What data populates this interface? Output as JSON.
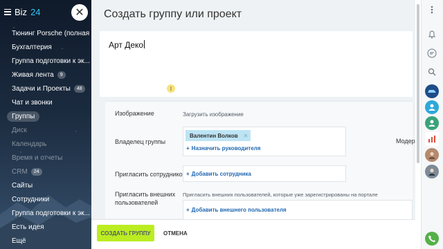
{
  "brand": {
    "name": "Biz",
    "suffix": "24"
  },
  "menu": [
    {
      "label": "Тюнинг Porsche (полная ...",
      "dim": false
    },
    {
      "label": "Бухгалтерия",
      "dim": false
    },
    {
      "label": "Группа подготовки к эк...",
      "dim": false
    },
    {
      "label": "Живая лента",
      "count": "9",
      "dim": false
    },
    {
      "label": "Задачи и Проекты",
      "count": "48",
      "dim": false
    },
    {
      "label": "Чат и звонки",
      "dim": false
    },
    {
      "label": "Группы",
      "dim": false,
      "active": true
    },
    {
      "label": "Диск",
      "dim": true
    },
    {
      "label": "Календарь",
      "dim": true
    },
    {
      "label": "Время и отчеты",
      "dim": true
    },
    {
      "label": "CRM",
      "count": "24",
      "dim": true
    },
    {
      "label": "Сайты",
      "dim": false
    },
    {
      "label": "Сотрудники",
      "dim": false
    },
    {
      "label": "Группа подготовки к эк...",
      "dim": false
    },
    {
      "label": "Есть идея",
      "dim": false
    },
    {
      "label": "Ещё",
      "dim": false
    }
  ],
  "panel": {
    "title": "Создать группу или проект",
    "name_value": "Арт Деко"
  },
  "form": {
    "image_label": "Изображение",
    "upload_link": "Загрузить изображение",
    "owner_label": "Владелец группы",
    "owner_name": "Валентин Волков",
    "assign_managers": "Назначить руководителя",
    "moderators_label": "Модера",
    "invite_label": "Пригласить сотрудников",
    "add_employee": "Добавить сотрудника",
    "invite_external_label": "Пригласить внешних пользователей",
    "external_hint": "Пригласить внешних пользователей, которые уже зарегистрированы на портале",
    "add_external": "Добавить внешнего пользователя"
  },
  "footer": {
    "create_label": "СОЗДАТЬ ГРУППУ",
    "cancel_label": "ОТМЕНА"
  },
  "colors": {
    "accent_green": "#bbed21",
    "link_blue": "#2067b0",
    "tag_blue": "#bde4f5",
    "brand_cyan": "#2fc6f6"
  }
}
